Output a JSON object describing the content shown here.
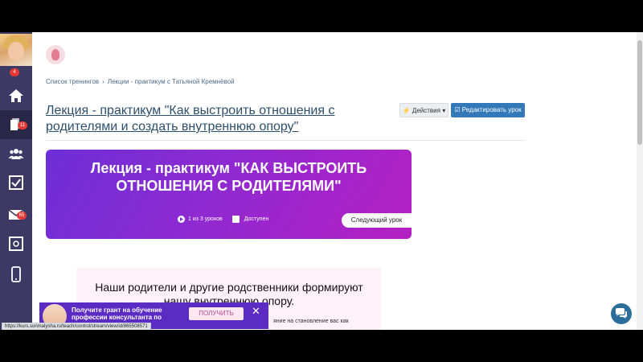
{
  "sidebar": {
    "avatar_badge": "4",
    "items": [
      {
        "icon": "home-icon"
      },
      {
        "icon": "book-icon",
        "badge": "11"
      },
      {
        "icon": "users-icon"
      },
      {
        "icon": "checkbox-icon"
      },
      {
        "icon": "mail-icon",
        "badge": "65"
      },
      {
        "icon": "safe-icon"
      },
      {
        "icon": "phone-icon"
      }
    ]
  },
  "breadcrumb": {
    "items": [
      "Список тренингов",
      "›",
      "Лекции - практикум с Татьяной Кремнёвой"
    ]
  },
  "lesson": {
    "title": "Лекция - практикум \"Как выстроить отношения с родителями и создать внутреннюю опору\"",
    "actions_label": "⚡ Действия ▾",
    "edit_label": "☑ Редактировать урок"
  },
  "banner": {
    "title": "Лекция - практикум \"КАК ВЫСТРОИТЬ ОТНОШЕНИЯ С РОДИТЕЛЯМИ\"",
    "progress": "1 из 3 уроков",
    "status": "Доступен",
    "next_label": "Следующий урок"
  },
  "content": {
    "text": "Наши родители и другие родственники формируют нашу внутреннюю опору.",
    "subtext": "яние на становление вас как"
  },
  "promo": {
    "text": "Получите грант на обучение профессии консультанта по",
    "button_label": "ПОЛУЧИТЬ",
    "close": "✕"
  },
  "status_url": "https://kurs.sonmalysha.ru/teach/control/stream/view/id/865508571",
  "colors": {
    "sidebar": "#3c3a64",
    "link": "#2c4f6e",
    "primary_button": "#3378b8",
    "banner_start": "#6d2ed8",
    "banner_end": "#b51fc3",
    "badge": "#e53935"
  }
}
